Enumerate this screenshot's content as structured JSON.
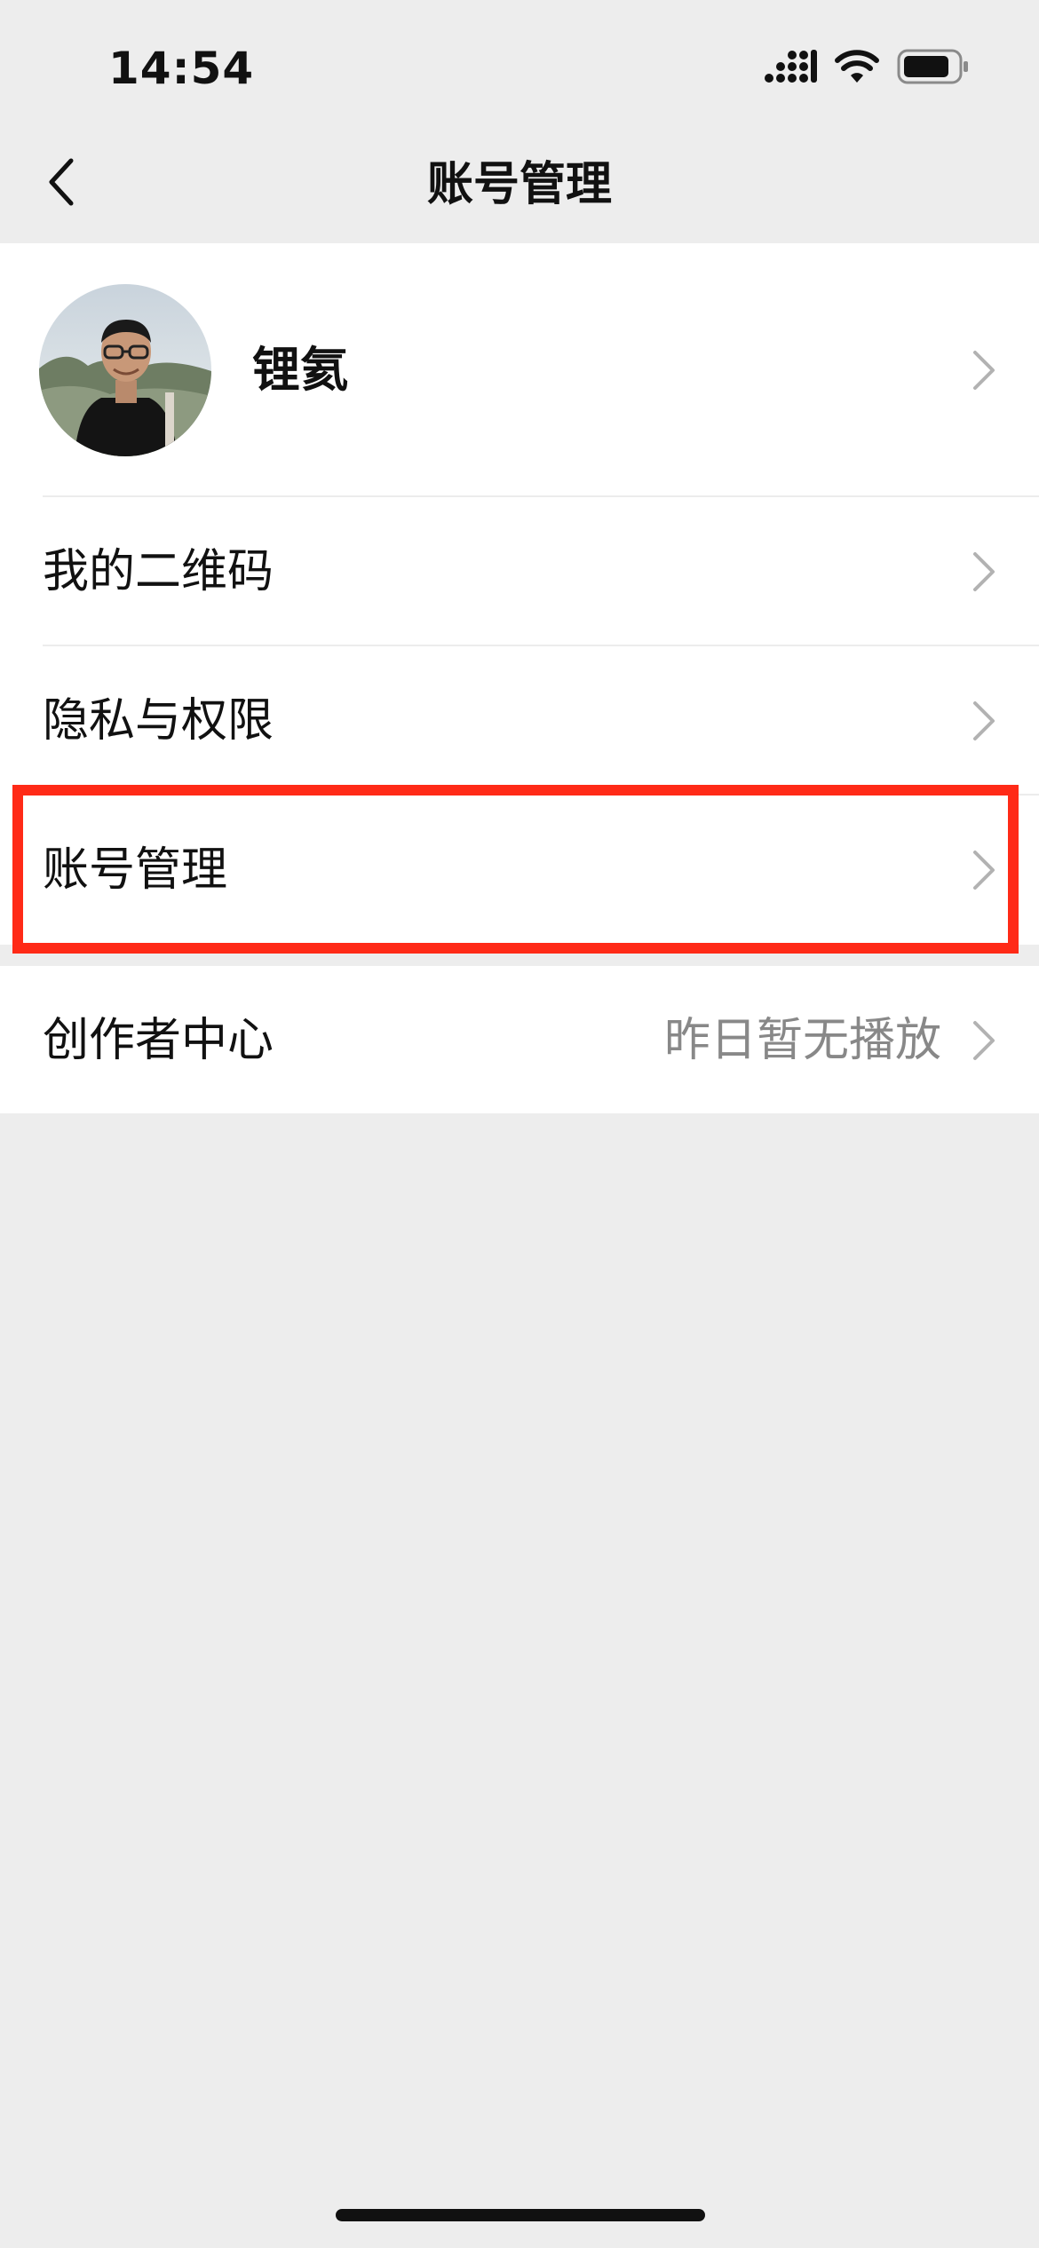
{
  "status_bar": {
    "time": "14:54",
    "icons": [
      "cellular-signal-icon",
      "wifi-icon",
      "battery-icon"
    ]
  },
  "nav": {
    "title": "账号管理",
    "back_icon": "chevron-left-icon"
  },
  "profile": {
    "name": "锂氦",
    "avatar": "user-avatar-photo"
  },
  "menu": {
    "items": [
      {
        "label": "我的二维码"
      },
      {
        "label": "隐私与权限"
      },
      {
        "label": "账号管理"
      }
    ]
  },
  "creator": {
    "label": "创作者中心",
    "status": "昨日暂无播放"
  },
  "colors": {
    "background": "#ededed",
    "card": "#ffffff",
    "highlight": "#ff2a17",
    "secondary_text": "#888888",
    "chevron": "#b2b2b2"
  }
}
